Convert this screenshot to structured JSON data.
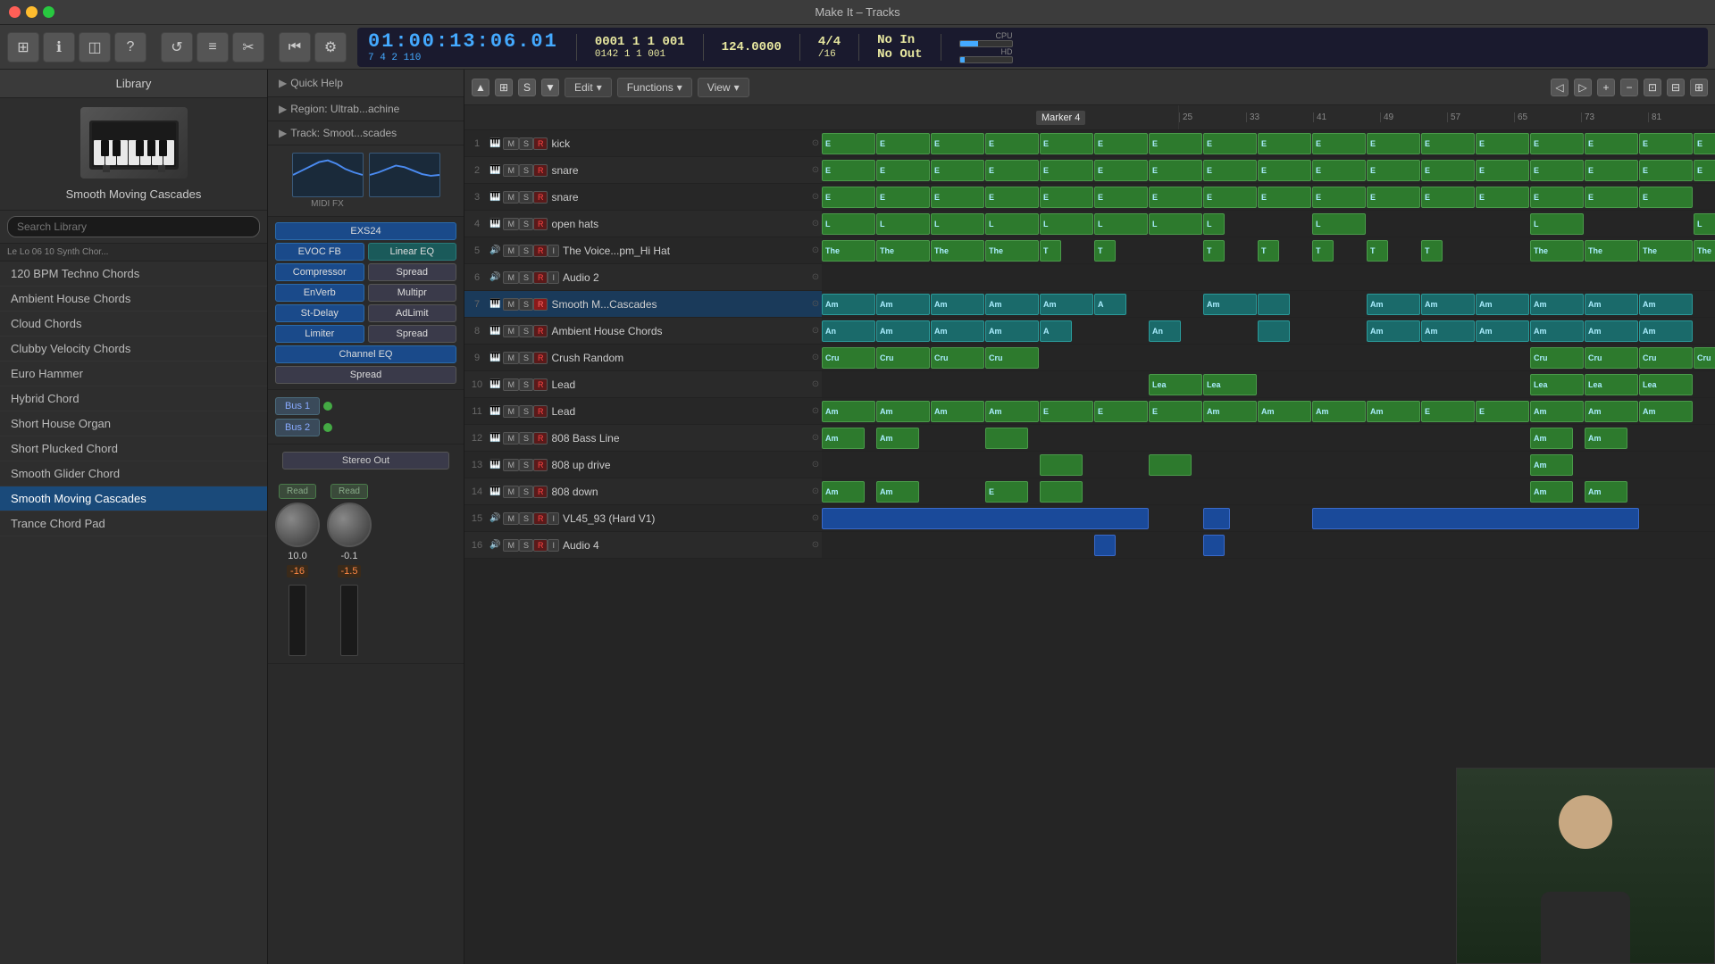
{
  "window": {
    "title": "Make It – Tracks"
  },
  "toolbar": {
    "transport_time": "01:00:13:06.01",
    "transport_sub": "7  4  2  110",
    "position1": "0001  1  1  001",
    "position2": "0142  1  1  001",
    "bpm": "124.0000",
    "time_sig": "4/4",
    "time_sig2": "/16",
    "in_label": "No In",
    "out_label": "No Out",
    "counter": "142",
    "cpu_label": "CPU",
    "hd_label": "HD"
  },
  "library": {
    "header": "Library",
    "instrument_name": "Smooth Moving Cascades",
    "search_placeholder": "Search Library",
    "breadcrumb": "Le  Lo  06  10 Synth Chor...",
    "items": [
      {
        "label": "120 BPM Techno Chords",
        "selected": false
      },
      {
        "label": "Ambient House Chords",
        "selected": false
      },
      {
        "label": "Cloud Chords",
        "selected": false
      },
      {
        "label": "Clubby Velocity Chords",
        "selected": false
      },
      {
        "label": "Euro Hammer",
        "selected": false
      },
      {
        "label": "Hybrid Chord",
        "selected": false
      },
      {
        "label": "Short House Organ",
        "selected": false
      },
      {
        "label": "Short Plucked Chord",
        "selected": false
      },
      {
        "label": "Smooth Glider Chord",
        "selected": false
      },
      {
        "label": "Smooth Moving Cascades",
        "selected": true
      },
      {
        "label": "Trance Chord Pad",
        "selected": false
      }
    ]
  },
  "channel": {
    "quick_help": "Quick Help",
    "region_label": "Region: Ultrab...achine",
    "track_label": "Track:  Smoot...scades",
    "plugin_label": "MIDI FX",
    "exs24": "EXS24",
    "evoc_fb": "EVOC FB",
    "compressor": "Compressor",
    "enverb": "EnVerb",
    "st_delay": "St-Delay",
    "limiter": "Limiter",
    "channel_eq": "Channel EQ",
    "spread1": "Spread",
    "linear_eq": "Linear EQ",
    "spread2": "Spread",
    "multipr": "Multipr",
    "adlimit": "AdLimit",
    "spread3": "Spread",
    "spread4": "Spread",
    "bus1": "Bus 1",
    "bus2": "Bus 2",
    "stereo_out": "Stereo Out",
    "read1": "Read",
    "read2": "Read",
    "fader1_val": "10.0",
    "fader1_db": "-16",
    "fader2_val": "-0.1",
    "fader2_db": "-1.5"
  },
  "track_editor": {
    "edit_label": "Edit",
    "functions_label": "Functions",
    "view_label": "View"
  },
  "ruler": {
    "marks": [
      "25",
      "33",
      "41",
      "49",
      "57",
      "65",
      "73",
      "81"
    ],
    "marker": "Marker 4"
  },
  "tracks": [
    {
      "num": 1,
      "name": "kick",
      "type": "midi"
    },
    {
      "num": 2,
      "name": "snare",
      "type": "midi"
    },
    {
      "num": 3,
      "name": "snare",
      "type": "midi"
    },
    {
      "num": 4,
      "name": "open hats",
      "type": "midi"
    },
    {
      "num": 5,
      "name": "The Voice...pm_Hi Hat",
      "type": "audio"
    },
    {
      "num": 6,
      "name": "Audio 2",
      "type": "audio"
    },
    {
      "num": 7,
      "name": "Smooth M...Cascades",
      "type": "midi",
      "selected": true
    },
    {
      "num": 8,
      "name": "Ambient House Chords",
      "type": "midi"
    },
    {
      "num": 9,
      "name": "Crush Random",
      "type": "midi"
    },
    {
      "num": 10,
      "name": "Lead",
      "type": "midi"
    },
    {
      "num": 11,
      "name": "Lead",
      "type": "midi"
    },
    {
      "num": 12,
      "name": "808 Bass Line",
      "type": "midi"
    },
    {
      "num": 13,
      "name": "808 up drive",
      "type": "midi"
    },
    {
      "num": 14,
      "name": "808 down",
      "type": "midi"
    },
    {
      "num": 15,
      "name": "VL45_93 (Hard V1)",
      "type": "audio"
    },
    {
      "num": 16,
      "name": "Audio 4",
      "type": "audio"
    }
  ]
}
